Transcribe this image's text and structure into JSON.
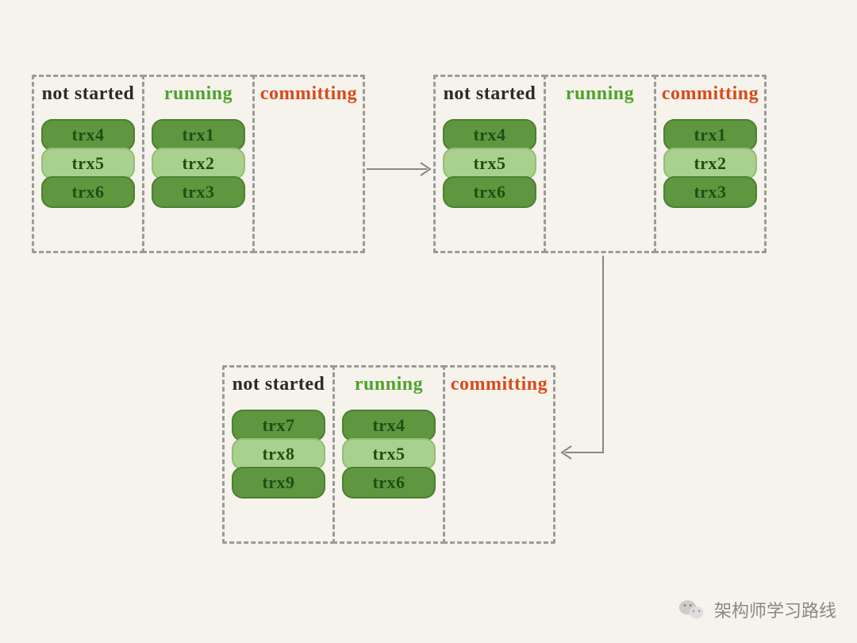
{
  "headers": {
    "not_started": "not started",
    "running": "running",
    "committing": "committing"
  },
  "stages": {
    "s1": {
      "not_started": [
        "trx4",
        "trx5",
        "trx6"
      ],
      "running": [
        "trx1",
        "trx2",
        "trx3"
      ],
      "committing": []
    },
    "s2": {
      "not_started": [
        "trx4",
        "trx5",
        "trx6"
      ],
      "running": [],
      "committing": [
        "trx1",
        "trx2",
        "trx3"
      ]
    },
    "s3": {
      "not_started": [
        "trx7",
        "trx8",
        "trx9"
      ],
      "running": [
        "trx4",
        "trx5",
        "trx6"
      ],
      "committing": []
    }
  },
  "colors": {
    "pill_dark": "#5e9740",
    "pill_light": "#a9d18e",
    "running_header": "#4fa22a",
    "committing_header": "#d94a1a",
    "border": "#9a9a9a",
    "background": "#f5f3ec"
  },
  "footer": {
    "label": "架构师学习路线",
    "icon": "wechat-icon"
  }
}
